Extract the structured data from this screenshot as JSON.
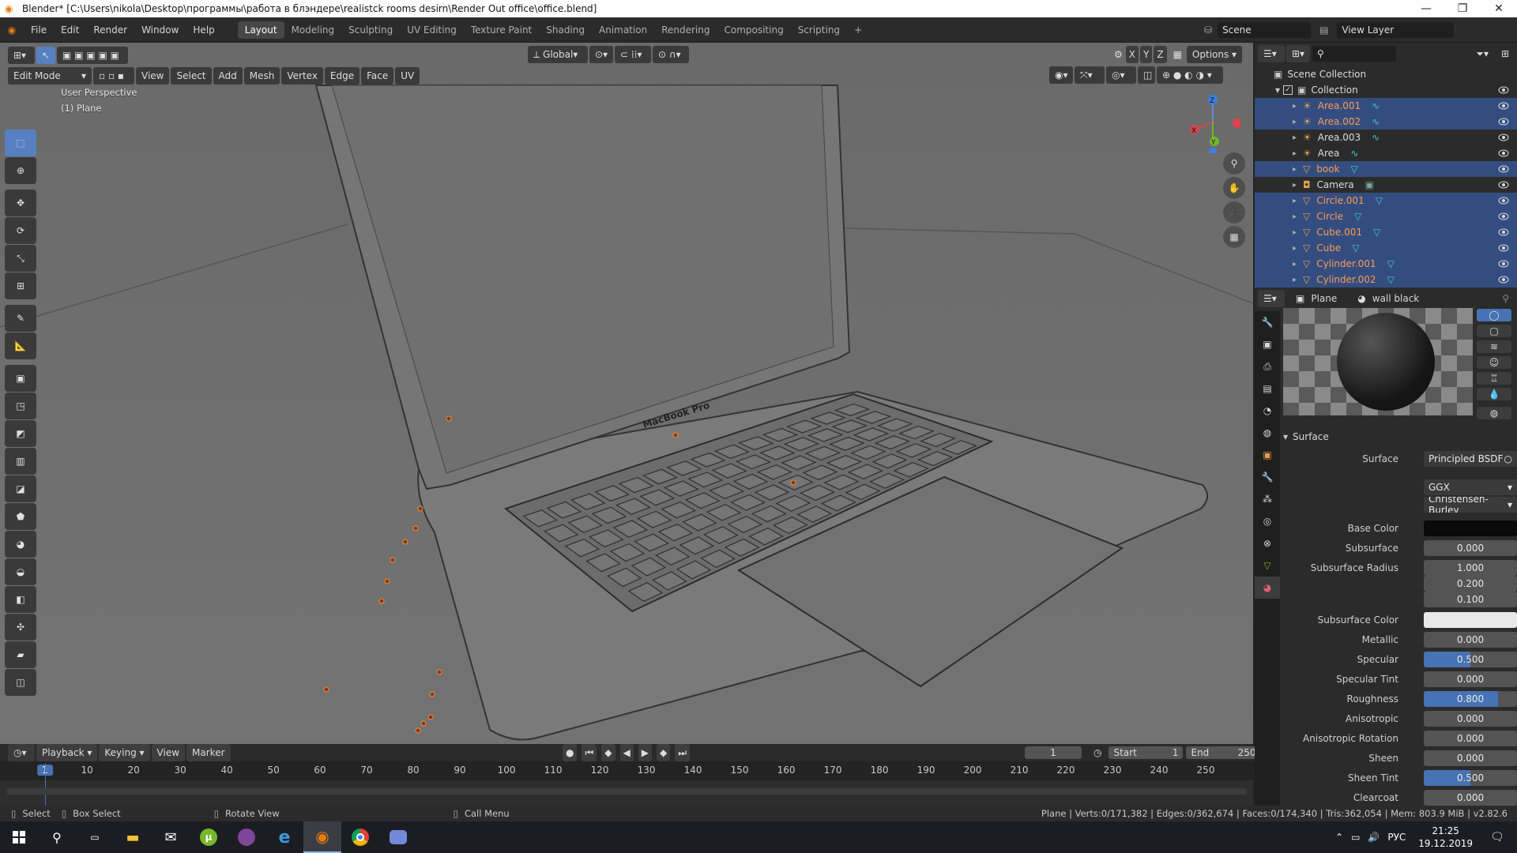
{
  "titlebar": {
    "title": "Blender* [C:\\Users\\nikola\\Desktop\\программы\\работа в блэндере\\realistck rooms desirn\\Render Out office\\office.blend]"
  },
  "menubar": {
    "menus": [
      "File",
      "Edit",
      "Render",
      "Window",
      "Help"
    ],
    "workspaces": [
      "Layout",
      "Modeling",
      "Sculpting",
      "UV Editing",
      "Texture Paint",
      "Shading",
      "Animation",
      "Rendering",
      "Compositing",
      "Scripting"
    ],
    "active_workspace": "Layout",
    "add_tab": "+",
    "scene_label": "Scene",
    "view_layer_label": "View Layer"
  },
  "viewport": {
    "mode": "Edit Mode",
    "menus": [
      "View",
      "Select",
      "Add",
      "Mesh",
      "Vertex",
      "Edge",
      "Face",
      "UV"
    ],
    "transform_orientation": "Global",
    "axis_labels": [
      "X",
      "Y",
      "Z"
    ],
    "options_label": "Options",
    "perspective_label": "User Perspective",
    "object_label": "(1) Plane",
    "model_label": "MacBook Pro"
  },
  "timeline": {
    "menus": [
      "Playback",
      "Keying",
      "View",
      "Marker"
    ],
    "current_frame": "1",
    "start_label": "Start",
    "start_value": "1",
    "end_label": "End",
    "end_value": "250",
    "ruler_marks": [
      "1",
      "10",
      "20",
      "30",
      "40",
      "50",
      "60",
      "70",
      "80",
      "90",
      "100",
      "110",
      "120",
      "130",
      "140",
      "150",
      "160",
      "170",
      "180",
      "190",
      "200",
      "210",
      "220",
      "230",
      "240",
      "250"
    ]
  },
  "statusbar": {
    "select": "Select",
    "box_select": "Box Select",
    "rotate_view": "Rotate View",
    "call_menu": "Call Menu",
    "stats": "Plane | Verts:0/171,382 | Edges:0/362,674 | Faces:0/174,340 | Tris:362,054 | Mem: 803.9 MiB | v2.82.6"
  },
  "outliner": {
    "scene_collection": "Scene Collection",
    "collection": "Collection",
    "items": [
      {
        "name": "Area.001",
        "selected": true,
        "type": "light"
      },
      {
        "name": "Area.002",
        "selected": true,
        "type": "light"
      },
      {
        "name": "Area.003",
        "selected": false,
        "type": "light"
      },
      {
        "name": "Area",
        "selected": false,
        "type": "light"
      },
      {
        "name": "book",
        "selected": true,
        "type": "mesh"
      },
      {
        "name": "Camera",
        "selected": false,
        "type": "camera"
      },
      {
        "name": "Circle.001",
        "selected": true,
        "type": "mesh"
      },
      {
        "name": "Circle",
        "selected": true,
        "type": "mesh"
      },
      {
        "name": "Cube.001",
        "selected": true,
        "type": "mesh"
      },
      {
        "name": "Cube",
        "selected": true,
        "type": "mesh"
      },
      {
        "name": "Cylinder.001",
        "selected": true,
        "type": "mesh"
      },
      {
        "name": "Cylinder.002",
        "selected": true,
        "type": "mesh"
      }
    ]
  },
  "properties": {
    "object_name": "Plane",
    "material_name": "wall black",
    "section": "Surface",
    "surface_label": "Surface",
    "surface_shader": "Principled BSDF",
    "distribution": "GGX",
    "subsurface_method": "Christensen-Burley",
    "fields": [
      {
        "label": "Base Color",
        "value": "",
        "kind": "color",
        "color": "#0a0a0a"
      },
      {
        "label": "Subsurface",
        "value": "0.000",
        "fill": 0
      },
      {
        "label": "Subsurface Radius",
        "value": "1.000",
        "fill": 0
      },
      {
        "label": "",
        "value": "0.200",
        "fill": 0
      },
      {
        "label": "",
        "value": "0.100",
        "fill": 0
      },
      {
        "label": "Subsurface Color",
        "value": "",
        "kind": "color",
        "color": "#e8e8e8"
      },
      {
        "label": "Metallic",
        "value": "0.000",
        "fill": 0
      },
      {
        "label": "Specular",
        "value": "0.500",
        "fill": 0.5
      },
      {
        "label": "Specular Tint",
        "value": "0.000",
        "fill": 0
      },
      {
        "label": "Roughness",
        "value": "0.800",
        "fill": 0.8
      },
      {
        "label": "Anisotropic",
        "value": "0.000",
        "fill": 0
      },
      {
        "label": "Anisotropic Rotation",
        "value": "0.000",
        "fill": 0
      },
      {
        "label": "Sheen",
        "value": "0.000",
        "fill": 0
      },
      {
        "label": "Sheen Tint",
        "value": "0.500",
        "fill": 0.5
      },
      {
        "label": "Clearcoat",
        "value": "0.000",
        "fill": 0
      }
    ]
  },
  "taskbar": {
    "language": "РУС",
    "time": "21:25",
    "date": "19.12.2019"
  },
  "colors": {
    "accent": "#4772b3",
    "selected_row": "#334d80",
    "object_orange": "#ff9a52",
    "viewport_bg": "#6f6f6f"
  }
}
